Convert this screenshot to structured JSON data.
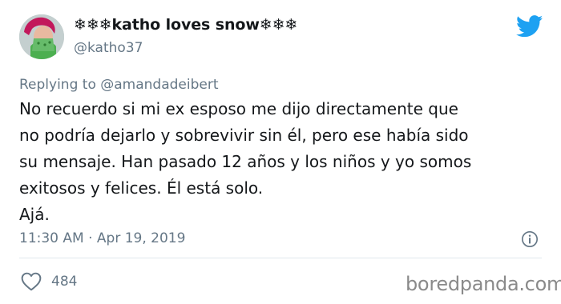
{
  "author": {
    "display_name": "❄❄❄katho loves snow❄❄❄",
    "handle": "@katho37"
  },
  "reply": {
    "prefix": "Replying to ",
    "mention": "@amandadeibert"
  },
  "tweet": {
    "lines": [
      "No recuerdo si mi ex esposo me dijo directamente que",
      "no podría dejarlo y sobrevivir sin él, pero ese había sido",
      "su mensaje. Han pasado 12 años y los niños y yo somos",
      "exitosos y felices. Él está solo.",
      "Ajá."
    ]
  },
  "meta": {
    "timestamp": "11:30 AM · Apr 19, 2019",
    "like_count": "484"
  },
  "watermark": "boredpanda.com",
  "icons": {
    "brand": "twitter-bird-icon",
    "info": "info-icon",
    "like": "heart-icon"
  },
  "colors": {
    "twitter_blue": "#1da1f2",
    "secondary_text": "#657786",
    "primary_text": "#14171a"
  }
}
